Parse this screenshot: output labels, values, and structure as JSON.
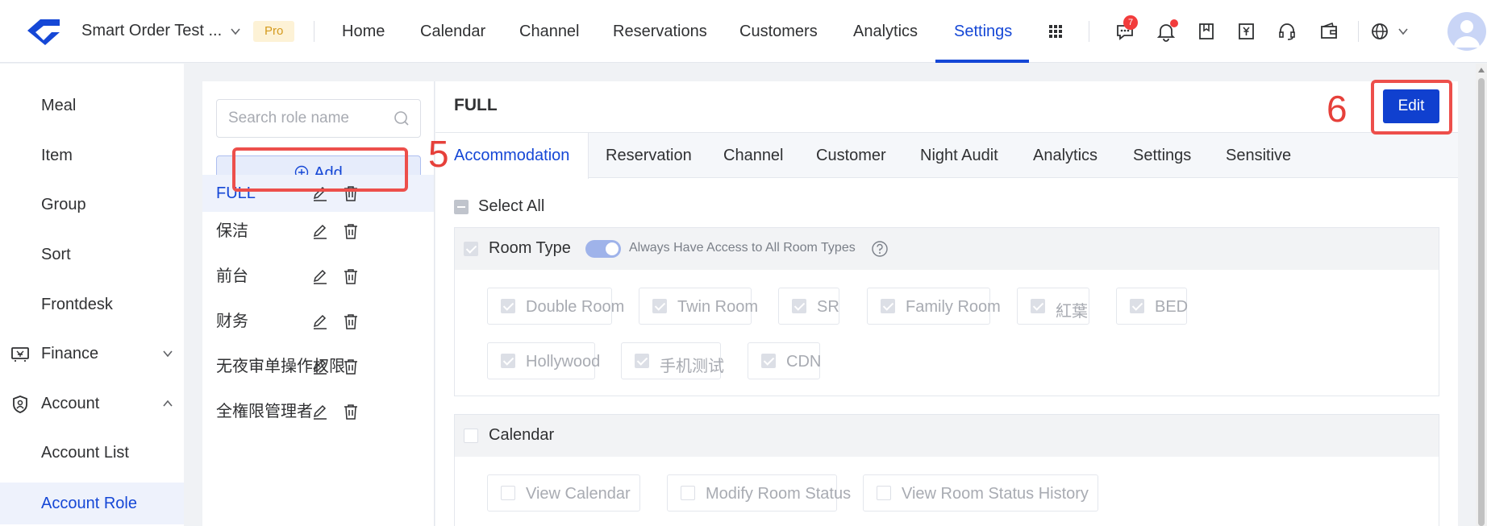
{
  "header": {
    "app_name": "Smart Order Test ...",
    "plan_badge": "Pro",
    "nav": [
      {
        "label": "Home"
      },
      {
        "label": "Calendar"
      },
      {
        "label": "Channel"
      },
      {
        "label": "Reservations"
      },
      {
        "label": "Customers"
      },
      {
        "label": "Analytics"
      },
      {
        "label": "Settings",
        "active": true
      }
    ],
    "message_count": "7",
    "icons": [
      "apps-grid-icon",
      "message-icon",
      "bell-icon",
      "bookmark-icon",
      "invoice-icon",
      "headset-icon",
      "wallet-icon",
      "globe-icon"
    ]
  },
  "sidebar": {
    "items": [
      {
        "label": "Meal"
      },
      {
        "label": "Item"
      },
      {
        "label": "Group"
      },
      {
        "label": "Sort"
      },
      {
        "label": "Frontdesk"
      },
      {
        "label": "Finance",
        "icon": "finance-icon",
        "expanded": false
      },
      {
        "label": "Account",
        "icon": "account-shield-icon",
        "expanded": true
      },
      {
        "label": "Account List"
      },
      {
        "label": "Account Role",
        "active": true
      }
    ]
  },
  "roles": {
    "search_placeholder": "Search role name",
    "add_label": "Add",
    "list": [
      {
        "name": "FULL",
        "active": true
      },
      {
        "name": "保洁"
      },
      {
        "name": "前台"
      },
      {
        "name": "财务"
      },
      {
        "name": "无夜审单操作权限"
      },
      {
        "name": "全権限管理者"
      }
    ]
  },
  "main": {
    "title": "FULL",
    "edit_label": "Edit",
    "tabs": [
      {
        "label": "Accommodation",
        "active": true
      },
      {
        "label": "Reservation"
      },
      {
        "label": "Channel"
      },
      {
        "label": "Customer"
      },
      {
        "label": "Night Audit"
      },
      {
        "label": "Analytics"
      },
      {
        "label": "Settings"
      },
      {
        "label": "Sensitive"
      }
    ],
    "select_all_label": "Select All",
    "room_type": {
      "label": "Room Type",
      "switch_label": "Always Have Access to All Room Types",
      "switch_on": true,
      "options": [
        {
          "label": "Double Room",
          "checked": true
        },
        {
          "label": "Twin Room",
          "checked": true
        },
        {
          "label": "SR",
          "checked": true
        },
        {
          "label": "Family Room",
          "checked": true
        },
        {
          "label": "紅葉",
          "checked": true
        },
        {
          "label": "BED",
          "checked": true
        },
        {
          "label": "Hollywood",
          "checked": true
        },
        {
          "label": "手机测试",
          "checked": true
        },
        {
          "label": "CDN",
          "checked": true
        }
      ]
    },
    "calendar": {
      "label": "Calendar",
      "options": [
        {
          "label": "View Calendar",
          "checked": false
        },
        {
          "label": "Modify Room Status",
          "checked": false
        },
        {
          "label": "View Room Status History",
          "checked": false
        }
      ]
    }
  },
  "annotations": {
    "step_add": "5",
    "step_edit": "6"
  },
  "colors": {
    "primary": "#1547d6",
    "edit_button": "#1040cf",
    "highlight_box": "#ed4f4b",
    "badge_red": "#f23c3c",
    "pro_badge_bg": "#fdf2d6",
    "pro_badge_text": "#d49a1e"
  }
}
